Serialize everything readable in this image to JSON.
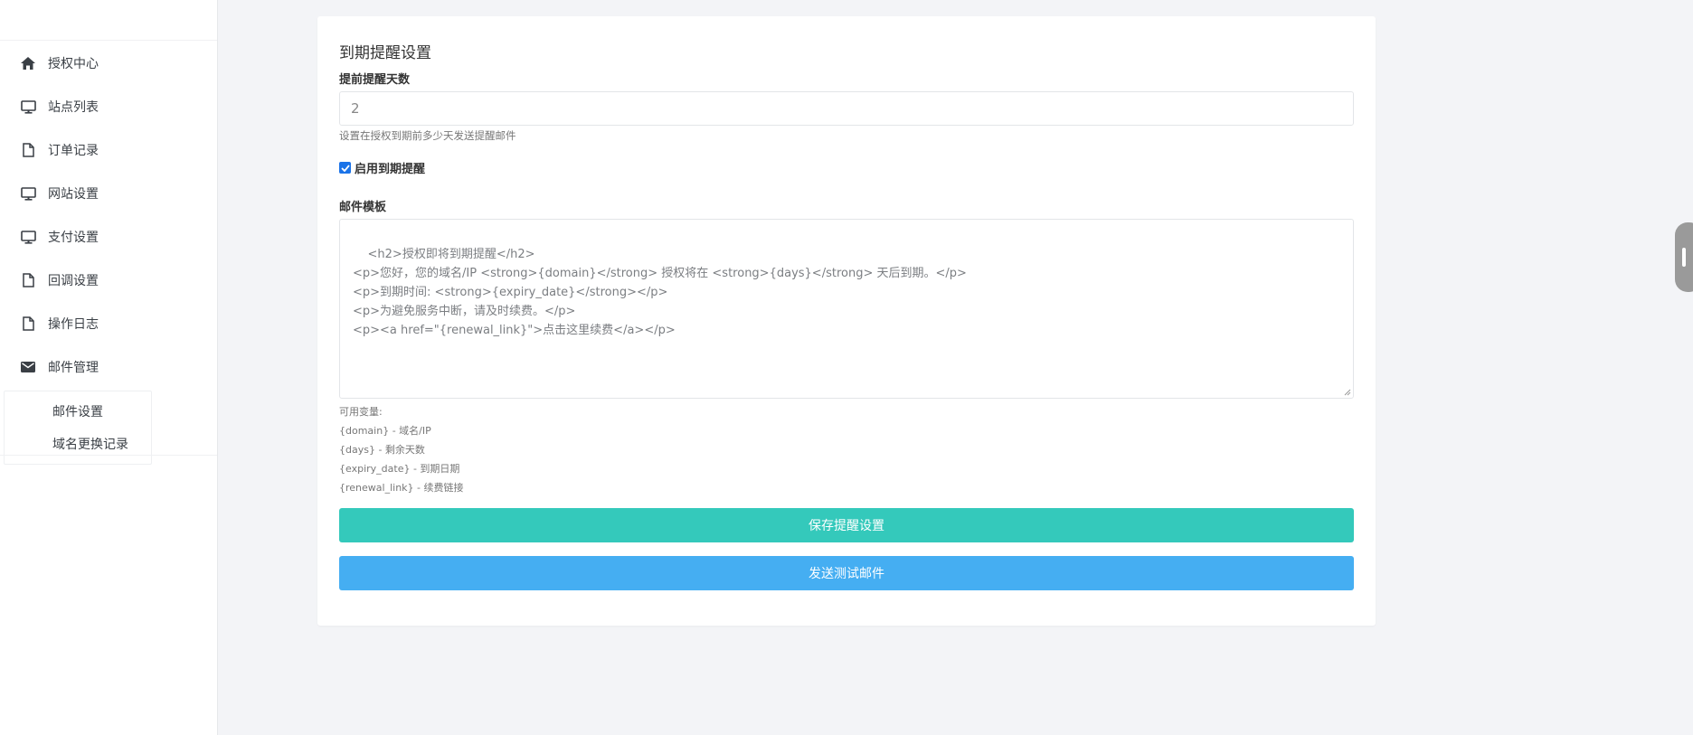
{
  "sidebar": {
    "items": [
      {
        "label": "授权中心",
        "icon": "home-icon"
      },
      {
        "label": "站点列表",
        "icon": "monitor-icon"
      },
      {
        "label": "订单记录",
        "icon": "file-icon"
      },
      {
        "label": "网站设置",
        "icon": "monitor-icon"
      },
      {
        "label": "支付设置",
        "icon": "monitor-icon"
      },
      {
        "label": "回调设置",
        "icon": "file-icon"
      },
      {
        "label": "操作日志",
        "icon": "file-icon"
      },
      {
        "label": "邮件管理",
        "icon": "mail-icon"
      }
    ],
    "submenu": [
      {
        "label": "邮件设置"
      },
      {
        "label": "域名更换记录"
      }
    ]
  },
  "form": {
    "title": "到期提醒设置",
    "days_label": "提前提醒天数",
    "days_value": "2",
    "days_help": "设置在授权到期前多少天发送提醒邮件",
    "enable_label": "启用到期提醒",
    "enable_checked": true,
    "template_label": "邮件模板",
    "template_value": "<h2>授权即将到期提醒</h2>\n<p>您好，您的域名/IP <strong>{domain}</strong> 授权将在 <strong>{days}</strong> 天后到期。</p>\n<p>到期时间: <strong>{expiry_date}</strong></p>\n<p>为避免服务中断，请及时续费。</p>\n<p><a href=\"{renewal_link}\">点击这里续费</a></p>",
    "vars_title": "可用变量:",
    "vars": [
      "{domain} - 域名/IP",
      "{days} - 剩余天数",
      "{expiry_date} - 到期日期",
      "{renewal_link} - 续费链接"
    ],
    "save_label": "保存提醒设置",
    "test_label": "发送测试邮件"
  },
  "colors": {
    "save_button": "#34c9bb",
    "test_button": "#45aef2",
    "checkbox": "#1a73e8"
  }
}
